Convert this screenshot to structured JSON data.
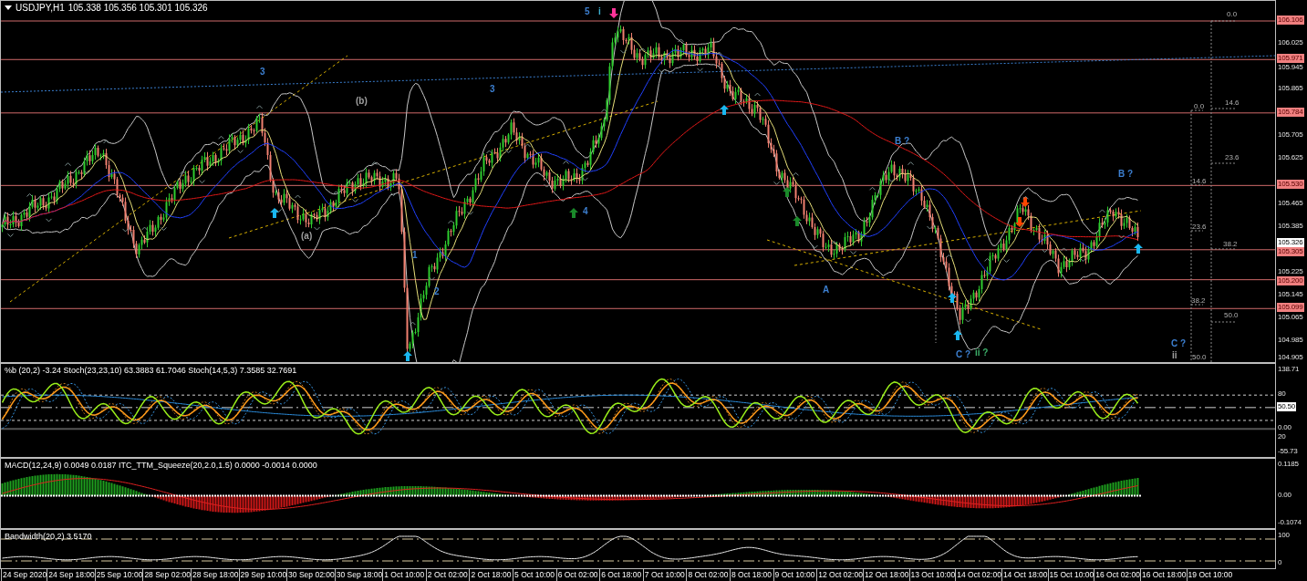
{
  "header": {
    "symbol": "USDJPY,H1",
    "quote": "105.338 105.356 105.301 105.326"
  },
  "price_axis": [
    {
      "text": "106.106",
      "kind": "level"
    },
    {
      "text": "106.025",
      "kind": "tick"
    },
    {
      "text": "105.971",
      "kind": "level"
    },
    {
      "text": "105.945",
      "kind": "tick"
    },
    {
      "text": "105.865",
      "kind": "tick"
    },
    {
      "text": "105.784",
      "kind": "level"
    },
    {
      "text": "105.705",
      "kind": "tick"
    },
    {
      "text": "105.625",
      "kind": "tick"
    },
    {
      "text": "105.530",
      "kind": "level"
    },
    {
      "text": "105.465",
      "kind": "tick"
    },
    {
      "text": "105.385",
      "kind": "tick"
    },
    {
      "text": "105.326",
      "kind": "current"
    },
    {
      "text": "105.305",
      "kind": "level"
    },
    {
      "text": "105.225",
      "kind": "tick"
    },
    {
      "text": "105.200",
      "kind": "level"
    },
    {
      "text": "105.145",
      "kind": "tick"
    },
    {
      "text": "105.099",
      "kind": "level"
    },
    {
      "text": "105.065",
      "kind": "tick"
    },
    {
      "text": "104.985",
      "kind": "tick"
    },
    {
      "text": "104.905",
      "kind": "tick"
    }
  ],
  "wave_labels": [
    {
      "text": "5",
      "color": "#3c7fd0"
    },
    {
      "text": "i",
      "color": "#3cb0d0"
    },
    {
      "text": "3",
      "color": "#3c7fd0"
    },
    {
      "text": "(b)",
      "color": "#a0a0a0"
    },
    {
      "text": "3",
      "color": "#3c7fd0"
    },
    {
      "text": "(a)",
      "color": "#a0a0a0"
    },
    {
      "text": "1",
      "color": "#3c7fd0"
    },
    {
      "text": "2",
      "color": "#3c7fd0"
    },
    {
      "text": "4",
      "color": "#3c7fd0"
    },
    {
      "text": "B ?",
      "color": "#3c7fd0"
    },
    {
      "text": "A",
      "color": "#3c7fd0"
    },
    {
      "text": "C ?",
      "color": "#3c7fd0"
    },
    {
      "text": "ii ?",
      "color": "#3cb06a"
    },
    {
      "text": "B ?",
      "color": "#3c7fd0"
    },
    {
      "text": "C ?",
      "color": "#3c7fd0"
    },
    {
      "text": "ii",
      "color": "#a0a0a0"
    }
  ],
  "fib_labels": [
    "0.0",
    "14.6",
    "23.6",
    "38.2",
    "50.0",
    "0.0",
    "14.6",
    "23.6",
    "38.2",
    "50.0"
  ],
  "panes": [
    {
      "title": "%b (20,2) -3.24  Stoch(23,23,10) 63.3883 61.7046  Stoch(14,5,3) 7.3585 32.7691",
      "axis": [
        {
          "text": "138.71",
          "kind": "tick"
        },
        {
          "text": "80",
          "kind": "tick"
        },
        {
          "text": "50.50",
          "kind": "current"
        },
        {
          "text": "0.00",
          "kind": "tick"
        },
        {
          "text": "20",
          "kind": "tick"
        },
        {
          "text": "-55.73",
          "kind": "tick"
        }
      ]
    },
    {
      "title": "MACD(12,24,9) 0.0049 0.0187  ITC_TTM_Squeeze(20,2.0,1.5) 0.0000 -0.0014 0.0000",
      "axis": [
        {
          "text": "0.1185",
          "kind": "tick"
        },
        {
          "text": "0.00",
          "kind": "tick"
        },
        {
          "text": "-0.1074",
          "kind": "tick"
        }
      ]
    },
    {
      "title": "Bandwidth(20,2) 3.5170",
      "axis": [
        {
          "text": "100",
          "kind": "tick"
        },
        {
          "text": "0",
          "kind": "tick"
        }
      ]
    }
  ],
  "time_axis": [
    "24 Sep 2020",
    "24 Sep 18:00",
    "25 Sep 10:00",
    "28 Sep 02:00",
    "28 Sep 18:00",
    "29 Sep 10:00",
    "30 Sep 02:00",
    "30 Sep 18:00",
    "1 Oct 10:00",
    "2 Oct 02:00",
    "2 Oct 18:00",
    "5 Oct 10:00",
    "6 Oct 02:00",
    "6 Oct 18:00",
    "7 Oct 10:00",
    "8 Oct 02:00",
    "8 Oct 18:00",
    "9 Oct 10:00",
    "12 Oct 02:00",
    "12 Oct 18:00",
    "13 Oct 10:00",
    "14 Oct 02:00",
    "14 Oct 18:00",
    "15 Oct 10:00",
    "16 Oct 02:00",
    "16 Oct 18:00",
    "19 Oct 10:00"
  ]
}
